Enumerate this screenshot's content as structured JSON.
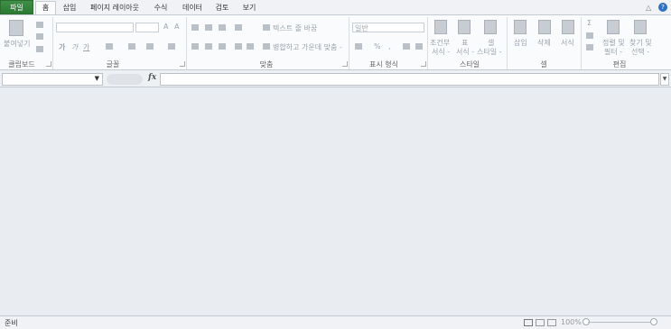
{
  "tabs": {
    "file": "파일",
    "home": "홈",
    "insert": "삽입",
    "page_layout": "페이지 레이아웃",
    "formulas": "수식",
    "data": "데이터",
    "review": "검토",
    "view": "보기"
  },
  "ribbon": {
    "clipboard": {
      "label": "클립보드",
      "paste": "붙여넣기"
    },
    "font": {
      "label": "글꼴",
      "bold": "가",
      "italic": "가",
      "underline": "가"
    },
    "alignment": {
      "label": "맞춤",
      "wrap_text": "텍스트 줄 바꿈",
      "merge_center": "병합하고 가운데 맞춤 -"
    },
    "number": {
      "label": "표시 형식",
      "format_value": "일반",
      "percent": "%",
      "comma": ","
    },
    "styles": {
      "label": "스타일",
      "conditional": "조건부",
      "conditional2": "서식 -",
      "table": "표",
      "table2": "서식 -",
      "cell": "셀",
      "cell2": "스타일 -"
    },
    "cells": {
      "label": "셀",
      "insert": "삽입",
      "delete": "삭제",
      "format": "서식"
    },
    "editing": {
      "label": "편집",
      "sort": "정렬 및",
      "sort2": "필터 -",
      "find": "찾기 및",
      "find2": "선택 -"
    }
  },
  "formula_bar": {
    "fx": "fx"
  },
  "status": {
    "ready": "준비",
    "zoom": "100%"
  }
}
